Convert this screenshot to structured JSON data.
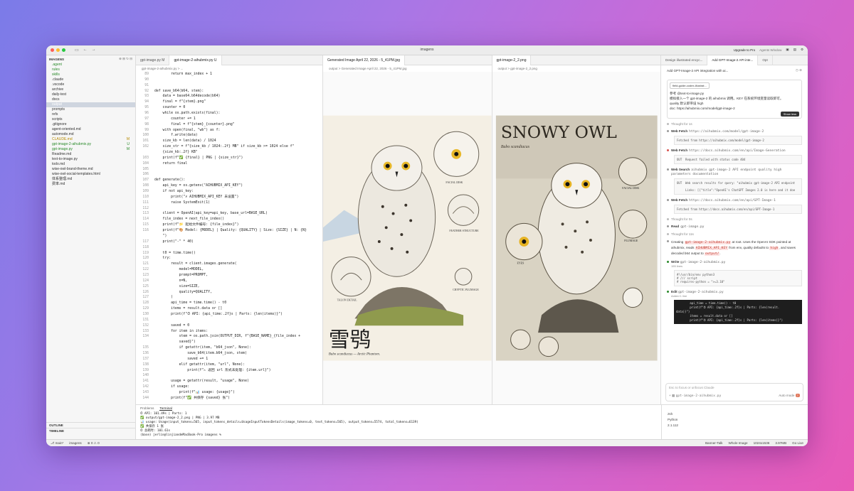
{
  "window": {
    "title": "imagens",
    "upgrade": "Upgrade to Pro",
    "agents": "Agents Window"
  },
  "sidebar": {
    "root": "IMAGENS",
    "items": [
      {
        "label": ".agent",
        "cls": "green"
      },
      {
        "label": "rules",
        "cls": "green"
      },
      {
        "label": "skills",
        "cls": "green"
      },
      {
        "label": ".claude",
        "cls": ""
      },
      {
        "label": ".vscode",
        "cls": ""
      },
      {
        "label": "archive",
        "cls": ""
      },
      {
        "label": "daily-test",
        "cls": ""
      },
      {
        "label": "docs",
        "cls": ""
      },
      {
        "label": "output",
        "cls": "sel"
      },
      {
        "label": "prompts",
        "cls": ""
      },
      {
        "label": "refs",
        "cls": ""
      },
      {
        "label": "scripts",
        "cls": ""
      },
      {
        "label": ".gitignore",
        "cls": ""
      },
      {
        "label": "agent-oriented.md",
        "cls": ""
      },
      {
        "label": "automode.md",
        "cls": ""
      },
      {
        "label": "CLAUDE.md",
        "cls": "yellow",
        "badge": "M"
      },
      {
        "label": "gpt-image-2-aihubmix.py",
        "cls": "green",
        "badge": "U"
      },
      {
        "label": "gpt-image.py",
        "cls": "green",
        "badge": "M"
      },
      {
        "label": "Readme.md",
        "cls": ""
      },
      {
        "label": "text-to-image.py",
        "cls": ""
      },
      {
        "label": "todo.md",
        "cls": ""
      },
      {
        "label": "wise-owl-brand-theme.md",
        "cls": ""
      },
      {
        "label": "wise-owl-social-templates.html",
        "cls": ""
      },
      {
        "label": "体系整理.md",
        "cls": ""
      },
      {
        "label": "费率.md",
        "cls": ""
      }
    ],
    "outline": "OUTLINE",
    "timeline": "TIMELINE"
  },
  "editor": {
    "tabs": [
      "gpt-image.py M",
      "gpt-image-2-aihubmix.py U"
    ],
    "crumb": "gpt-image-2-aihubmix.py > ...",
    "lines": [
      {
        "n": "89",
        "t": "        return max_index + 1"
      },
      {
        "n": "90",
        "t": ""
      },
      {
        "n": "91",
        "t": ""
      },
      {
        "n": "92",
        "t": "def save_b64(b64, stem):"
      },
      {
        "n": "93",
        "t": "    data = base64.b64decode(b64)"
      },
      {
        "n": "94",
        "t": "    final = f\"{stem}.png\""
      },
      {
        "n": "95",
        "t": "    counter = 0"
      },
      {
        "n": "96",
        "t": "    while os.path.exists(final):"
      },
      {
        "n": "97",
        "t": "        counter += 1"
      },
      {
        "n": "98",
        "t": "        final = f\"{stem}_{counter}.png\""
      },
      {
        "n": "99",
        "t": "    with open(final, \"wb\") as f:"
      },
      {
        "n": "100",
        "t": "        f.write(data)"
      },
      {
        "n": "101",
        "t": "    size_kb = len(data) / 1024"
      },
      {
        "n": "102",
        "t": "    size_str = f\"{size_kb / 1024:.2f} MB\" if size_kb >= 1024 else f\""
      },
      {
        "n": "",
        "t": "    {size_kb:.2f} KB\""
      },
      {
        "n": "103",
        "t": "    print(f\"✅ {final} | PNG | {size_str}\")"
      },
      {
        "n": "104",
        "t": "    return final"
      },
      {
        "n": "105",
        "t": ""
      },
      {
        "n": "106",
        "t": ""
      },
      {
        "n": "107",
        "t": "def generate():"
      },
      {
        "n": "108",
        "t": "    api_key = os.getenv(\"AIHUBMIX_API_KEY\")"
      },
      {
        "n": "109",
        "t": "    if not api_key:"
      },
      {
        "n": "110",
        "t": "        print(\"✗ AIHUBMIX_API_KEY 未设置\")"
      },
      {
        "n": "111",
        "t": "        raise SystemExit(1)"
      },
      {
        "n": "112",
        "t": ""
      },
      {
        "n": "113",
        "t": "    client = OpenAI(api_key=api_key, base_url=BASE_URL)"
      },
      {
        "n": "114",
        "t": "    file_index = next_file_index()"
      },
      {
        "n": "115",
        "t": "    print(f\"📁 起始文件编号: {file_index}\")"
      },
      {
        "n": "116",
        "t": "    print(f\"🎨 Model: {MODEL} | Quality: {QUALITY} | Size: {SIZE} | N: {N}"
      },
      {
        "n": "",
        "t": "    \")"
      },
      {
        "n": "117",
        "t": "    print(\"-\" * 40)"
      },
      {
        "n": "118",
        "t": ""
      },
      {
        "n": "119",
        "t": "    t0 = time.time()"
      },
      {
        "n": "120",
        "t": "    try:"
      },
      {
        "n": "121",
        "t": "        result = client.images.generate("
      },
      {
        "n": "122",
        "t": "            model=MODEL,"
      },
      {
        "n": "123",
        "t": "            prompt=PROMPT,"
      },
      {
        "n": "124",
        "t": "            n=N,"
      },
      {
        "n": "125",
        "t": "            size=SIZE,"
      },
      {
        "n": "126",
        "t": "            quality=QUALITY,"
      },
      {
        "n": "127",
        "t": "        )"
      },
      {
        "n": "128",
        "t": "        api_time = time.time() - t0"
      },
      {
        "n": "129",
        "t": "        items = result.data or []"
      },
      {
        "n": "130",
        "t": "        print(f\"⏱ API: {api_time:.2f}s | Parts: {len(items)}\")"
      },
      {
        "n": "131",
        "t": ""
      },
      {
        "n": "132",
        "t": "        saved = 0"
      },
      {
        "n": "133",
        "t": "        for item in items:"
      },
      {
        "n": "134",
        "t": "            stem = os.path.join(OUTPUT_DIR, f\"{BASE_NAME}_{file_index +"
      },
      {
        "n": "",
        "t": "            saved}\")"
      },
      {
        "n": "135",
        "t": "            if getattr(item, \"b64_json\", None):"
      },
      {
        "n": "136",
        "t": "                save_b64(item.b64_json, stem)"
      },
      {
        "n": "137",
        "t": "                saved += 1"
      },
      {
        "n": "138",
        "t": "            elif getattr(item, \"url\", None):"
      },
      {
        "n": "139",
        "t": "                print(f\"⚠ 返回 url 形式未处理: {item.url}\")"
      },
      {
        "n": "140",
        "t": ""
      },
      {
        "n": "141",
        "t": "        usage = getattr(result, \"usage\", None)"
      },
      {
        "n": "142",
        "t": "        if usage:"
      },
      {
        "n": "143",
        "t": "            print(f\"📊 usage: {usage}\")"
      },
      {
        "n": "144",
        "t": "        print(f\"✅ 共保存 {saved} 张\")"
      }
    ]
  },
  "images": [
    {
      "tab": "Generated Image April 22, 2026 - 5_41PM.jpg",
      "crumb": "output > Generated Image April 22, 2026 - 5_41PM.jpg",
      "title": "雪鸮",
      "subtitle": "Bubo scandiacus — Arctic Phantom.",
      "labels": [
        "FACIAL DISK",
        "FEATHER STRUCTURE",
        "CRYPTIC PLUMAGE",
        "TALON DETAIL"
      ]
    },
    {
      "tab": "gpt-image-2_2.png",
      "crumb": "output > gpt-image-2_2.png",
      "title": "SNOWY OWL",
      "subtitle": "Bubo scandiacus",
      "labels": [
        "FACIAL DISK",
        "PLUMAGE",
        "EYES"
      ]
    }
  ],
  "chat": {
    "tabs": [
      "Design illustrated encyc...",
      "Add GPT-Image-2 API inte...",
      "Opt"
    ],
    "header": "Add GPT-Image-2 API integration with ai...",
    "user_file": "field-guide-codex-illustrat...",
    "user_lines": [
      "参考 @text-to-image.py",
      "模拟接入一个 gpt-image-2 的 aihubmix 调用。KEY 在系统环境变量读取即可。",
      "quality 默认即带设 high",
      "doc: https://aihubmix.com/model/gpt-image-2"
    ],
    "show_less": "Show less",
    "steps": [
      {
        "kind": "Thought for 1s",
        "detail": "",
        "box": "",
        "color": "#bbb"
      },
      {
        "kind": "Web Fetch",
        "detail": "https://aihubmix.com/model/gpt-image-2",
        "box": "Fetched from https://aihubmix.com/model/gpt-image-2",
        "color": "#999"
      },
      {
        "kind": "Web Fetch",
        "detail": "https://docs.aihubmix.com/en/api/Image-Generation",
        "box": "OUT  Request failed with status code 404",
        "color": "#d9534f"
      },
      {
        "kind": "Web Search",
        "detail": "aihubmix gpt-image-2 API endpoint quality high parameters documentation",
        "box": "OUT  Web search results for query: \"aihubmix gpt-image-2 API endpoint\n\n     Links: [{\"title\":\"OpenAI's ChatGPT Images 2.0 is here and it doe",
        "color": "#999"
      },
      {
        "kind": "Web Fetch",
        "detail": "https://docs.aihubmix.com/en/api/GPT-Image-1",
        "box": "Fetched from https://docs.aihubmix.com/en/api/GPT-Image-1",
        "color": "#999"
      },
      {
        "kind": "Thought for 0s",
        "detail": "",
        "box": "",
        "color": "#bbb"
      },
      {
        "kind": "Read",
        "detail": "gpt-image.py",
        "box": "",
        "color": "#999"
      },
      {
        "kind": "Thought for 11s",
        "detail": "",
        "box": "",
        "color": "#bbb"
      }
    ],
    "creating": [
      "Creating ",
      "gpt-image-2-aihubmix.py",
      " at root. Uses the OpenAI SDK pointed at aihubmix, reads ",
      "AIHUBMIX_API_KEY",
      " from env, quality defaults to ",
      "high",
      ", and saves decoded b64 output to ",
      "output/",
      "."
    ],
    "write": {
      "kind": "Write",
      "file": "gpt-image-2-aihubmix.py",
      "sub": "155 lines",
      "code": "#!/usr/bin/env python3\n# /// script\n# requires-python = \">=3.10\""
    },
    "edit": {
      "kind": "Edit",
      "file": "gpt-image-2-aihubmix.py",
      "sub": "Added 1 line",
      "code": "        api_time = time.time() - t0\n        print(f\"⏱ API: {api_time:.2f}s | Parts: {len(result.\ndata)}\")\n        items = result.data or []\n        print(f\"⏱ API: {api_time:.2f}s | Parts: {len(items)}\")"
    },
    "input_placeholder": "Esc to focus or unfocus Claude",
    "input_file": "gpt-image-2-aihubmix.py",
    "mode": "Auto mode"
  },
  "terminal": {
    "tabs": [
      "Problems",
      "Terminal"
    ],
    "lines": [
      "⏱ API: 101.49s | Parts: 1",
      "✅ output/gpt-image-2_2.png | PNG | 3.97 MB",
      "📊 usage: Usage(input_tokens=565, input_tokens_details=UsageInputTokensDetails(image_tokens=0, text_tokens=565), output_tokens=5574, total_tokens=6139)",
      "✅ 共保存 1 张",
      "⏱ 总耗时: 101.61s",
      "(base) jerlin@linjiandeMacBook-Pro imagens % "
    ],
    "side": [
      "zsh",
      "Python",
      "2.1.112"
    ]
  },
  "status": {
    "branch": "main*",
    "project": "imagens",
    "errors": "0",
    "warnings": "0",
    "right": [
      "Banner-Talk",
      "Whole Image",
      "1024x1536",
      "3.97MB",
      "Go Live"
    ]
  }
}
